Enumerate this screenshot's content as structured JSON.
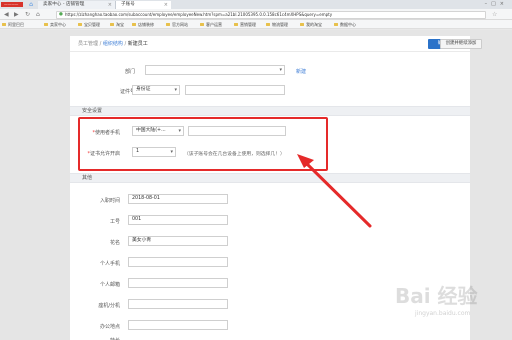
{
  "browser": {
    "app_badge": "————",
    "tabs": [
      {
        "label": "卖家中心 - 店铺管理"
      },
      {
        "label": "子账号"
      }
    ],
    "url": "https://zizhanghao.taobao.com/subaccount/employee/employeeNew.htm?spm=a21bl.21005395.0.0.158c61c4mXHPS&query=empty",
    "bookmarks": [
      "阿里巴巴",
      "卖家中心",
      "宝贝管理",
      "淘宝",
      "店铺装修",
      "官方网站",
      "客户运营",
      "营销管理",
      "物流管理",
      "我的淘宝",
      "数据中心"
    ]
  },
  "page": {
    "breadcrumb": {
      "root": "员工管理",
      "mid": "组织结构",
      "current": "新建员工"
    },
    "buttons": {
      "confirm": "确认新建",
      "create_continue": "创建并继续添加"
    },
    "fields": {
      "dept_label": "部门",
      "dept_value": "",
      "dept_new_link": "新建",
      "id_label": "证件号",
      "id_type": "身份证",
      "id_value": ""
    },
    "security": {
      "section": "安全设置",
      "phone_label": "使用者手机",
      "phone_country": "中国大陆(+...",
      "phone_value": "",
      "cert_label": "证书允许开启",
      "cert_value": "1",
      "cert_hint": "（该子账号会在几台设备上使用，则选择几！）"
    },
    "other": {
      "section": "其他",
      "hire_date_label": "入职时间",
      "hire_date_value": "2018-08-01",
      "emp_no_label": "工号",
      "emp_no_value": "001",
      "nickname_label": "花名",
      "nickname_value": "美女小青",
      "personal_phone_label": "个人手机",
      "personal_email_label": "个人邮箱",
      "landline_label": "座机/分机",
      "office_label": "办公地点",
      "specialty_label": "特长"
    }
  },
  "annotation": {
    "color": "#e52a2a"
  },
  "watermark": {
    "text": "Bai 经验",
    "sub": "jingyan.baidu.com"
  }
}
